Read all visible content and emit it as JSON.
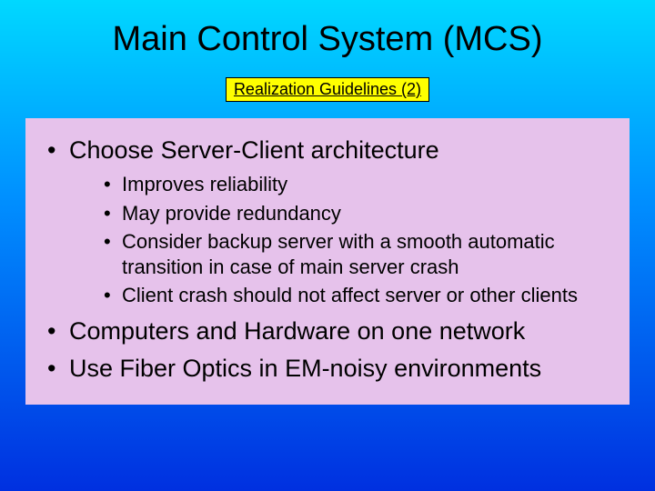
{
  "title": "Main Control System (MCS)",
  "subtitle": "Realization Guidelines (2)",
  "bullets": {
    "b0": "Choose Server-Client architecture",
    "b0_sub": {
      "s0": "Improves reliability",
      "s1": "May provide redundancy",
      "s2": "Consider backup server with a smooth automatic transition in case of main server crash",
      "s3": "Client crash should not affect server or other clients"
    },
    "b1": "Computers and Hardware on one network",
    "b2": "Use Fiber Optics in EM-noisy environments"
  }
}
